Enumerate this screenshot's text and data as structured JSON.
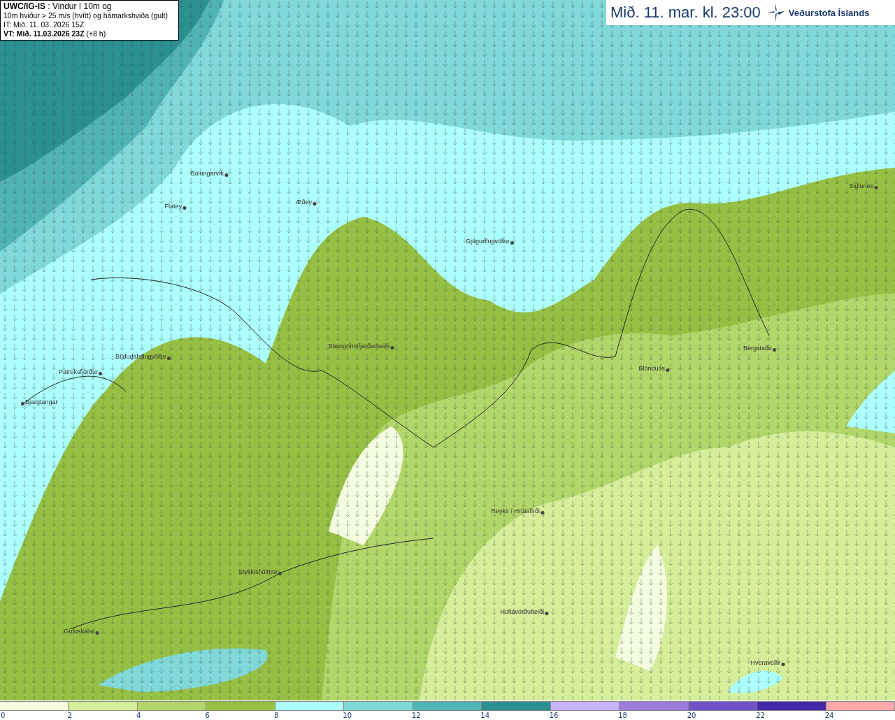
{
  "info_box": {
    "lines": [
      "**UWC/IG-IS** : Vindur í 10m og",
      "10m hviður > 25 m/s (hvítt) og hámarkshviða (gult)",
      "IT: Mið. 11. 03. 2026 15Z",
      "**VT: Mið. 11.03.2026 23Z** (+8 h)"
    ]
  },
  "title_bar": {
    "title": "Mið. 11. mar. kl. 23:00",
    "brand": "Veðurstofa Íslands"
  },
  "stations": [
    {
      "name": "Bolungarvík"
    },
    {
      "name": "Flatey"
    },
    {
      "name": "Æðey"
    },
    {
      "name": "Gjögurflugvöllur"
    },
    {
      "name": "Steingrímsfjarðarheiði"
    },
    {
      "name": "Bíldudalsflugvöllur"
    },
    {
      "name": "Patreksfjörður"
    },
    {
      "name": "Bjargtangar"
    },
    {
      "name": "Siglunes"
    },
    {
      "name": "Blönduós"
    },
    {
      "name": "Bergstaðir"
    },
    {
      "name": "Reykir í Hrútafirði"
    },
    {
      "name": "Stykkishólmur"
    },
    {
      "name": "Holtavörðuheiði"
    },
    {
      "name": "Gufuskálar"
    },
    {
      "name": "Hveravellir"
    }
  ],
  "legend": {
    "bins": [
      {
        "label": "0",
        "color": "#f5fde0"
      },
      {
        "label": "2",
        "color": "#d4ee9a"
      },
      {
        "label": "4",
        "color": "#b1d66a"
      },
      {
        "label": "6",
        "color": "#96c044"
      },
      {
        "label": "8",
        "color": "#adfffd"
      },
      {
        "label": "10",
        "color": "#80d8d8"
      },
      {
        "label": "12",
        "color": "#50b4b4"
      },
      {
        "label": "14",
        "color": "#2a9090"
      },
      {
        "label": "16",
        "color": "#c8b4fc"
      },
      {
        "label": "18",
        "color": "#9c7cdc"
      },
      {
        "label": "20",
        "color": "#7050c8"
      },
      {
        "label": "22",
        "color": "#4428a8"
      },
      {
        "label": "24",
        "color": "#fca8a8"
      }
    ]
  }
}
